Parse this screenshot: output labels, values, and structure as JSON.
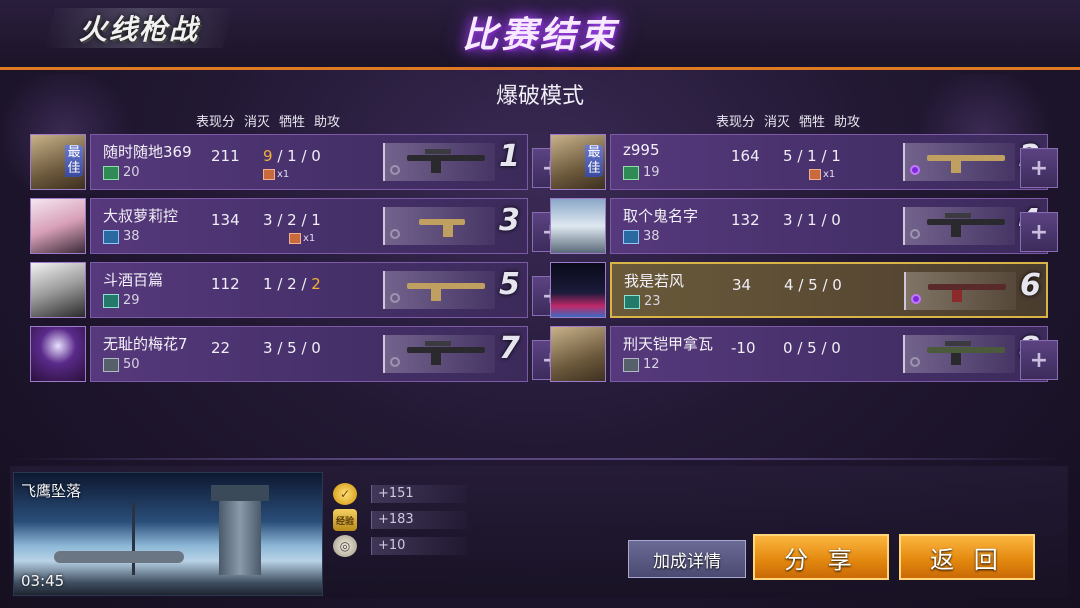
{
  "header": {
    "logo_text": "火线枪战",
    "title": "比赛结束",
    "mode": "爆破模式"
  },
  "columns": {
    "score": "表现分",
    "kills": "消灭",
    "deaths": "牺牲",
    "assists": "助攻"
  },
  "team_left": [
    {
      "name": "随时随地369",
      "level": "20",
      "score": "211",
      "k": "9",
      "d": "1",
      "a": "0",
      "mvp": "最佳",
      "medal": "x1",
      "rank": "1",
      "k_hl": true,
      "a_hl": false,
      "rank_icon": "green-emblem",
      "weapon": "sniper-rifle"
    },
    {
      "name": "大叔萝莉控",
      "level": "38",
      "score": "134",
      "k": "3",
      "d": "2",
      "a": "1",
      "mvp": "",
      "medal": "x1",
      "rank": "3",
      "k_hl": false,
      "a_hl": false,
      "rank_icon": "blue-emblem",
      "weapon": "smg-gold"
    },
    {
      "name": "斗酒百篇",
      "level": "29",
      "score": "112",
      "k": "1",
      "d": "2",
      "a": "2",
      "mvp": "",
      "medal": "",
      "rank": "5",
      "k_hl": false,
      "a_hl": true,
      "rank_icon": "teal-emblem",
      "weapon": "assault-rifle-gold"
    },
    {
      "name": "无耻的梅花7",
      "level": "50",
      "score": "22",
      "k": "3",
      "d": "5",
      "a": "0",
      "mvp": "",
      "medal": "",
      "rank": "7",
      "k_hl": false,
      "a_hl": false,
      "rank_icon": "gray-emblem",
      "weapon": "assault-rifle"
    }
  ],
  "team_right": [
    {
      "name": "z995",
      "level": "19",
      "score": "164",
      "k": "5",
      "d": "1",
      "a": "1",
      "mvp": "最佳",
      "medal": "x1",
      "rank": "2",
      "rank_icon": "green-emblem",
      "weapon": "ak-gold"
    },
    {
      "name": "取个鬼名字",
      "level": "38",
      "score": "132",
      "k": "3",
      "d": "1",
      "a": "0",
      "mvp": "",
      "medal": "",
      "rank": "4",
      "rank_icon": "blue-emblem",
      "weapon": "sniper-rifle"
    },
    {
      "name": "我是若风",
      "level": "23",
      "score": "34",
      "k": "4",
      "d": "5",
      "a": "0",
      "mvp": "",
      "medal": "",
      "rank": "6",
      "rank_icon": "teal-emblem",
      "weapon": "m4-red",
      "highlight": true
    },
    {
      "name": "刑天铠甲拿瓦",
      "level": "12",
      "score": "-10",
      "k": "0",
      "d": "5",
      "a": "0",
      "mvp": "",
      "medal": "",
      "rank": "8",
      "rank_icon": "gray-emblem",
      "weapon": "sniper-rifle-green"
    }
  ],
  "map": {
    "name": "飞鹰坠落",
    "time": "03:45"
  },
  "rewards": {
    "coins": "+151",
    "exp": "+183",
    "honor": "+10",
    "exp_icon_text": "经验"
  },
  "buttons": {
    "detail": "加成详情",
    "share": "分 享",
    "back": "返 回"
  }
}
